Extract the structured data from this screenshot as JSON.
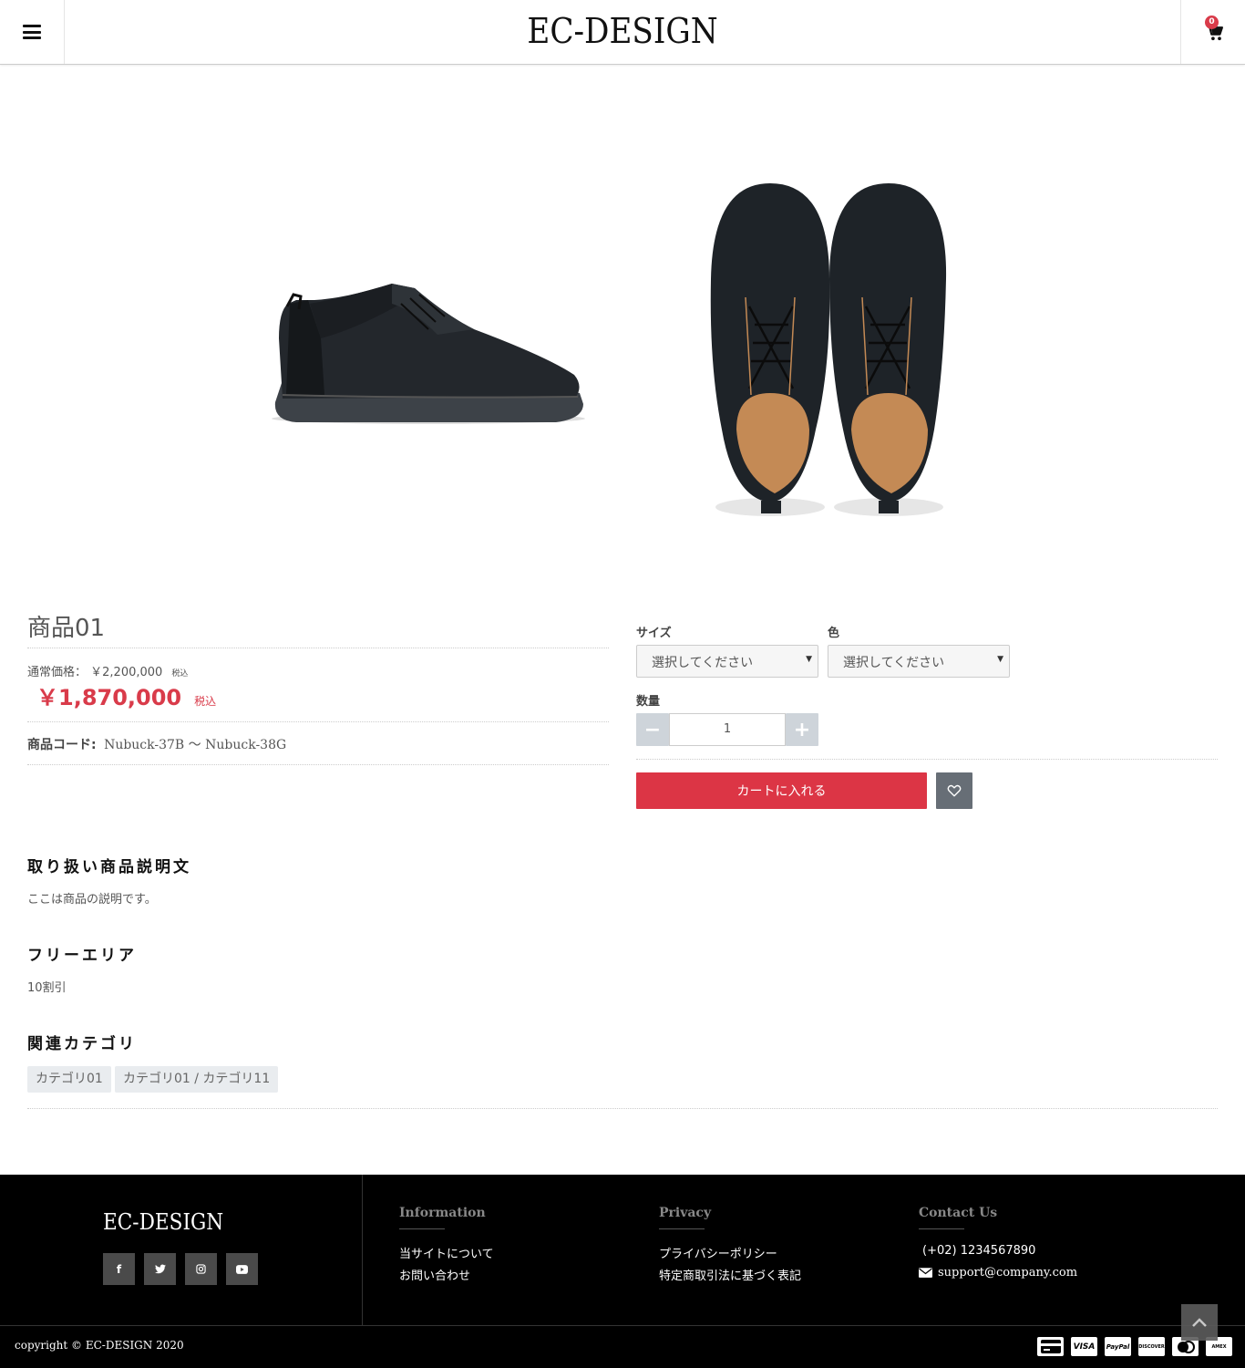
{
  "header": {
    "logo": "EC-DESIGN",
    "cart_count": "0"
  },
  "product": {
    "name": "商品01",
    "regular_label": "通常価格：",
    "regular_price": "￥2,200,000",
    "regular_tax": "税込",
    "price": "￥1,870,000",
    "price_tax": "税込",
    "code_label": "商品コード:",
    "code_value": "Nubuck-37B ～ Nubuck-38G"
  },
  "form": {
    "size_label": "サイズ",
    "size_value": "選択してください",
    "color_label": "色",
    "color_value": "選択してください",
    "qty_label": "数量",
    "qty_value": "1",
    "minus": "−",
    "plus": "+",
    "add_to_cart": "カートに入れる"
  },
  "description": {
    "title": "取り扱い商品説明文",
    "text": "ここは商品の説明です。"
  },
  "free_area": {
    "title": "フリーエリア",
    "text": "10割引"
  },
  "related": {
    "title": "関連カテゴリ",
    "tags": [
      "カテゴリ01",
      "カテゴリ01 / カテゴリ11"
    ]
  },
  "footer": {
    "logo": "EC-DESIGN",
    "social": [
      "f",
      "t",
      "ig",
      "yt"
    ],
    "info_title": "Information",
    "info_links": [
      "当サイトについて",
      "お問い合わせ"
    ],
    "privacy_title": "Privacy",
    "privacy_links": [
      "プライバシーポリシー",
      "特定商取引法に基づく表記"
    ],
    "contact_title": "Contact Us",
    "phone": "(+02) 1234567890",
    "email": "support@company.com",
    "copyright": "copyright © EC-DESIGN 2020",
    "payments": [
      "card",
      "VISA",
      "PayPal",
      "DISCOVER",
      "master",
      "AMEX"
    ]
  },
  "colors": {
    "accent": "#dc3545",
    "footer_bg": "#000000"
  }
}
